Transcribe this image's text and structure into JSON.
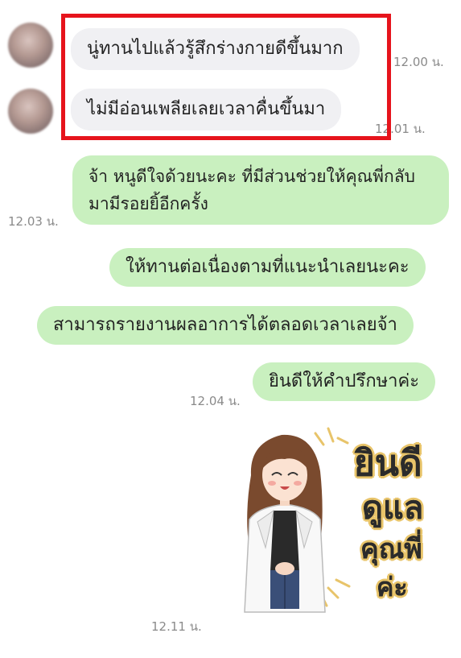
{
  "messages": {
    "incoming": [
      {
        "text": "นู่ทานไปแล้วรู้สึกร่างกายดีขึ้นมาก",
        "time": "12.00 น."
      },
      {
        "text": "ไม่มีอ่อนเพลียเลยเวลาคื่นขึ้นมา",
        "time": "12.01 น."
      }
    ],
    "outgoing": [
      {
        "text": "จ้า หนูดีใจด้วยนะคะ ที่มีส่วนช่วยให้คุณพี่กลับมามีรอยยิ้อีกครั้ง",
        "time": "12.03 น."
      },
      {
        "text": "ให้ทานต่อเนื่องตามที่แนะนำเลยนะคะ"
      },
      {
        "text": "สามารถรายงานผลอาการได้ตลอดเวลาเลยจ้า"
      },
      {
        "text": "ยินดีให้คำปรึกษาค่ะ",
        "time": "12.04 น."
      }
    ],
    "sticker": {
      "line1": "ยินดี",
      "line2": "ดูแล",
      "line3": "คุณพี่",
      "line4": "ค่ะ",
      "time": "12.11 น."
    }
  },
  "colors": {
    "incoming_bubble": "#f0f0f3",
    "outgoing_bubble": "#c9f0bf",
    "highlight_border": "#e6141c",
    "timestamp": "#8a8a8a"
  }
}
